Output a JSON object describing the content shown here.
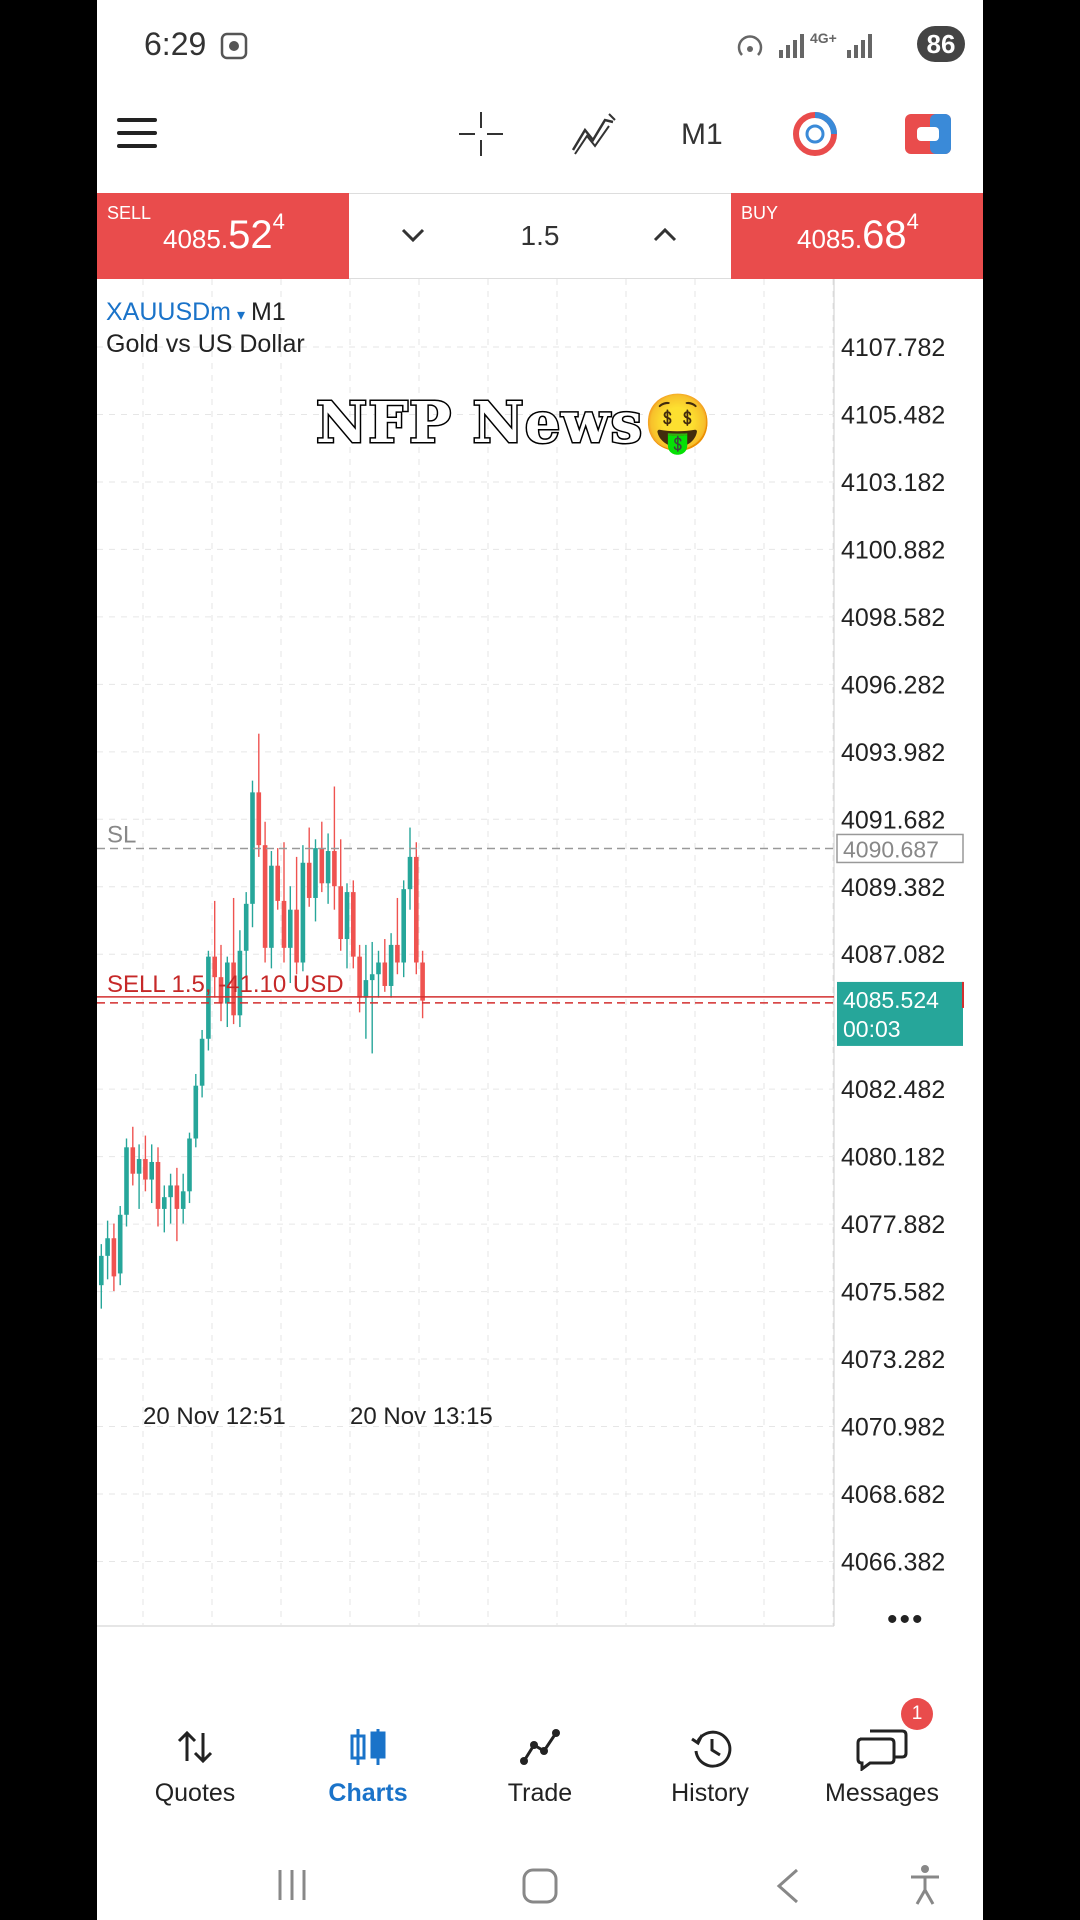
{
  "status_bar": {
    "time": "6:29",
    "battery": "86",
    "network": "4G+"
  },
  "toolbar": {
    "timeframe": "M1"
  },
  "trade_bar": {
    "sell": {
      "label": "SELL",
      "price_small": "4085.",
      "price_big": "52",
      "price_sup": "4"
    },
    "buy": {
      "label": "BUY",
      "price_small": "4085.",
      "price_big": "68",
      "price_sup": "4"
    },
    "lot": "1.5"
  },
  "chart": {
    "symbol": "XAUUSDm",
    "timeframe": "M1",
    "description": "Gold vs US Dollar",
    "overlay_text": "NFP News",
    "overlay_emoji": "🤑",
    "sl_label": "SL",
    "sl_price": "4090.687",
    "order_label": "SELL 1.5, -41.10 USD",
    "current_price": "4085.524",
    "countdown": "00:03",
    "price_ticks": [
      "4107.782",
      "4105.482",
      "4103.182",
      "4100.882",
      "4098.582",
      "4096.282",
      "4093.982",
      "4091.682",
      "4089.382",
      "4087.082",
      "4082.482",
      "4080.182",
      "4077.882",
      "4075.582",
      "4073.282",
      "4070.982",
      "4068.682",
      "4066.382"
    ],
    "time_labels": [
      "20 Nov 12:51",
      "20 Nov 13:15"
    ],
    "more_label": "•••"
  },
  "chart_data": {
    "type": "candlestick",
    "title": "",
    "ylim": [
      4063.5,
      4110.1
    ],
    "candles": [
      [
        4075.8,
        4077.2,
        4075.0,
        4076.8
      ],
      [
        4076.8,
        4078.0,
        4076.0,
        4077.4
      ],
      [
        4077.4,
        4077.9,
        4075.6,
        4076.1
      ],
      [
        4076.2,
        4078.5,
        4075.8,
        4078.2
      ],
      [
        4078.2,
        4080.8,
        4077.8,
        4080.5
      ],
      [
        4080.5,
        4081.2,
        4079.2,
        4079.6
      ],
      [
        4079.6,
        4080.6,
        4078.4,
        4080.1
      ],
      [
        4080.1,
        4080.9,
        4079.0,
        4079.4
      ],
      [
        4079.4,
        4080.6,
        4078.6,
        4080.0
      ],
      [
        4080.0,
        4080.5,
        4077.8,
        4078.4
      ],
      [
        4078.4,
        4079.2,
        4077.6,
        4078.8
      ],
      [
        4078.8,
        4079.6,
        4077.9,
        4079.2
      ],
      [
        4079.2,
        4079.8,
        4077.3,
        4078.4
      ],
      [
        4078.4,
        4079.6,
        4077.9,
        4079.0
      ],
      [
        4079.0,
        4081.0,
        4078.6,
        4080.8
      ],
      [
        4080.8,
        4083.0,
        4080.5,
        4082.6
      ],
      [
        4082.6,
        4084.5,
        4082.2,
        4084.2
      ],
      [
        4084.2,
        4087.2,
        4083.8,
        4087.0
      ],
      [
        4087.0,
        4088.9,
        4085.6,
        4086.3
      ],
      [
        4086.3,
        4087.4,
        4084.8,
        4085.4
      ],
      [
        4085.4,
        4087.0,
        4084.6,
        4086.8
      ],
      [
        4086.8,
        4089.0,
        4084.7,
        4085.0
      ],
      [
        4085.0,
        4087.9,
        4084.6,
        4087.2
      ],
      [
        4087.2,
        4089.2,
        4086.0,
        4088.8
      ],
      [
        4088.8,
        4093.0,
        4088.0,
        4092.6
      ],
      [
        4092.6,
        4094.6,
        4090.4,
        4090.8
      ],
      [
        4090.8,
        4091.6,
        4086.8,
        4087.3
      ],
      [
        4087.3,
        4090.6,
        4086.6,
        4090.1
      ],
      [
        4090.1,
        4090.7,
        4088.6,
        4088.9
      ],
      [
        4088.9,
        4090.9,
        4086.8,
        4087.3
      ],
      [
        4087.3,
        4089.4,
        4086.1,
        4088.6
      ],
      [
        4088.6,
        4090.4,
        4086.4,
        4086.8
      ],
      [
        4086.8,
        4090.8,
        4086.5,
        4090.2
      ],
      [
        4090.2,
        4091.4,
        4088.7,
        4089.0
      ],
      [
        4089.0,
        4091.0,
        4088.2,
        4090.7
      ],
      [
        4090.7,
        4091.6,
        4089.2,
        4089.5
      ],
      [
        4089.5,
        4091.2,
        4088.8,
        4090.6
      ],
      [
        4090.6,
        4092.8,
        4088.6,
        4089.4
      ],
      [
        4089.4,
        4091.0,
        4087.2,
        4087.6
      ],
      [
        4087.6,
        4089.5,
        4086.6,
        4089.2
      ],
      [
        4089.2,
        4089.6,
        4086.6,
        4087.0
      ],
      [
        4087.0,
        4087.4,
        4085.1,
        4085.6
      ],
      [
        4085.6,
        4087.4,
        4084.2,
        4086.2
      ],
      [
        4086.2,
        4087.5,
        4083.7,
        4086.4
      ],
      [
        4086.4,
        4087.2,
        4085.6,
        4086.8
      ],
      [
        4086.8,
        4087.6,
        4085.8,
        4086.0
      ],
      [
        4086.0,
        4087.8,
        4085.6,
        4087.4
      ],
      [
        4087.4,
        4089.0,
        4086.4,
        4086.8
      ],
      [
        4086.8,
        4089.6,
        4086.3,
        4089.3
      ],
      [
        4089.3,
        4091.4,
        4088.6,
        4090.4
      ],
      [
        4090.4,
        4090.9,
        4086.4,
        4086.8
      ],
      [
        4086.8,
        4087.2,
        4084.9,
        4085.5
      ]
    ]
  },
  "bottom_nav": [
    {
      "label": "Quotes",
      "icon": "sort-arrows-icon",
      "active": false
    },
    {
      "label": "Charts",
      "icon": "candles-icon",
      "active": true
    },
    {
      "label": "Trade",
      "icon": "trend-line-icon",
      "active": false
    },
    {
      "label": "History",
      "icon": "history-clock-icon",
      "active": false
    },
    {
      "label": "Messages",
      "icon": "chat-bubbles-icon",
      "active": false,
      "badge": "1"
    }
  ],
  "colors": {
    "accent": "#1a73c9",
    "sell": "#e94c4c",
    "bull": "#26a69a",
    "bear": "#ef5350"
  }
}
